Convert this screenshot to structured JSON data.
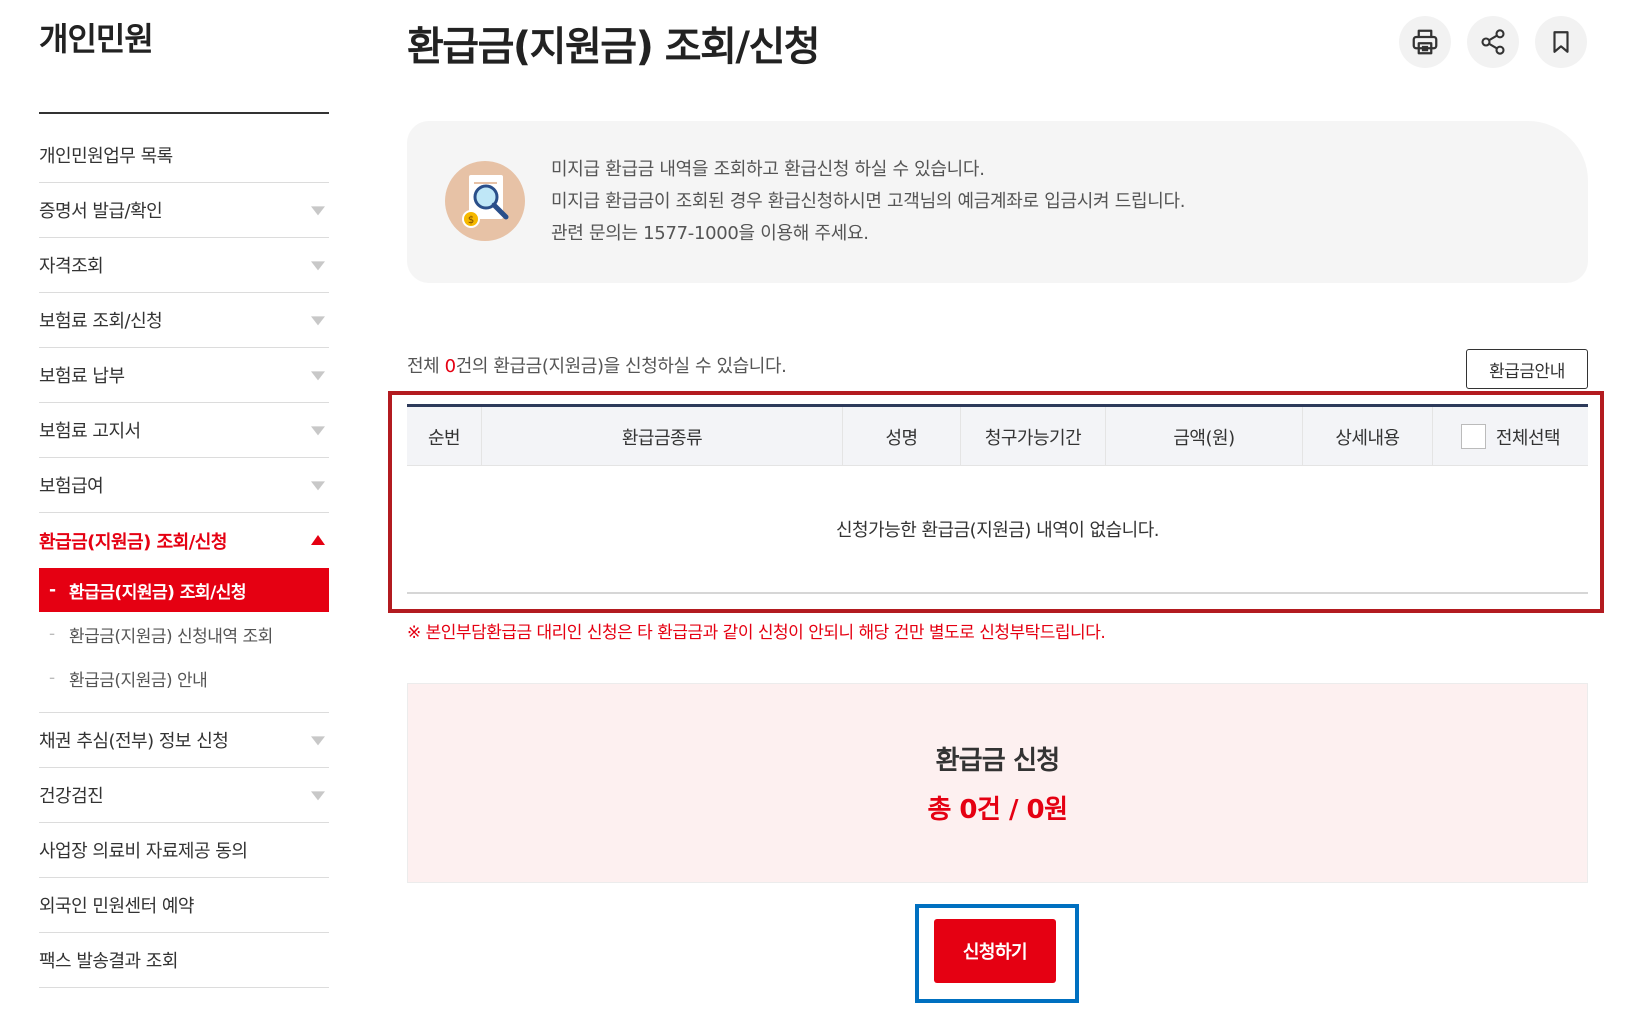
{
  "sidebar": {
    "title": "개인민원",
    "items": [
      {
        "label": "개인민원업무 목록",
        "has_arrow": false
      },
      {
        "label": "증명서 발급/확인",
        "has_arrow": true
      },
      {
        "label": "자격조회",
        "has_arrow": true
      },
      {
        "label": "보험료 조회/신청",
        "has_arrow": true
      },
      {
        "label": "보험료 납부",
        "has_arrow": true
      },
      {
        "label": "보험료 고지서",
        "has_arrow": true
      },
      {
        "label": "보험급여",
        "has_arrow": true
      },
      {
        "label": "환급금(지원금) 조회/신청",
        "expanded": true
      },
      {
        "label": "채권 추심(전부) 정보 신청",
        "has_arrow": true
      },
      {
        "label": "건강검진",
        "has_arrow": true
      },
      {
        "label": "사업장 의료비 자료제공 동의",
        "has_arrow": false
      },
      {
        "label": "외국인 민원센터 예약",
        "has_arrow": false
      },
      {
        "label": "팩스 발송결과 조회",
        "has_arrow": false
      }
    ],
    "submenu": [
      {
        "label": "환급금(지원금) 조회/신청",
        "active": true
      },
      {
        "label": "환급금(지원금) 신청내역 조회"
      },
      {
        "label": "환급금(지원금) 안내"
      }
    ],
    "dash": "-"
  },
  "header": {
    "title": "환급금(지원금) 조회/신청",
    "tools": [
      "printer-icon",
      "share-icon",
      "bookmark-icon"
    ]
  },
  "info": {
    "lines": [
      "미지급 환급금 내역을 조회하고 환급신청 하실 수 있습니다.",
      "미지급 환급금이 조회된 경우 환급신청하시면 고객님의 예금계좌로 입금시켜 드립니다.",
      "관련 문의는 1577-1000을 이용해 주세요."
    ],
    "icon": "search-document-icon"
  },
  "count": {
    "prefix": "전체 ",
    "number": "0",
    "suffix": "건의 환급금(지원금)을 신청하실 수 있습니다."
  },
  "guide_button": "환급금안내",
  "table": {
    "columns": [
      "순번",
      "환급금종류",
      "성명",
      "청구가능기간",
      "금액(원)",
      "상세내용",
      "전체선택"
    ],
    "empty_message": "신청가능한 환급금(지원금) 내역이 없습니다."
  },
  "notice": "※ 본인부담환급금 대리인 신청은 타 환급금과 같이 신청이 안되니 해당 건만 별도로 신청부탁드립니다.",
  "summary": {
    "title": "환급금 신청",
    "total": "총 0건 / 0원"
  },
  "apply_button": "신청하기",
  "colors": {
    "accent": "#e50012",
    "table_highlight": "#b31b20",
    "button_highlight": "#0070c0",
    "table_top_border": "#2d3a5a"
  }
}
